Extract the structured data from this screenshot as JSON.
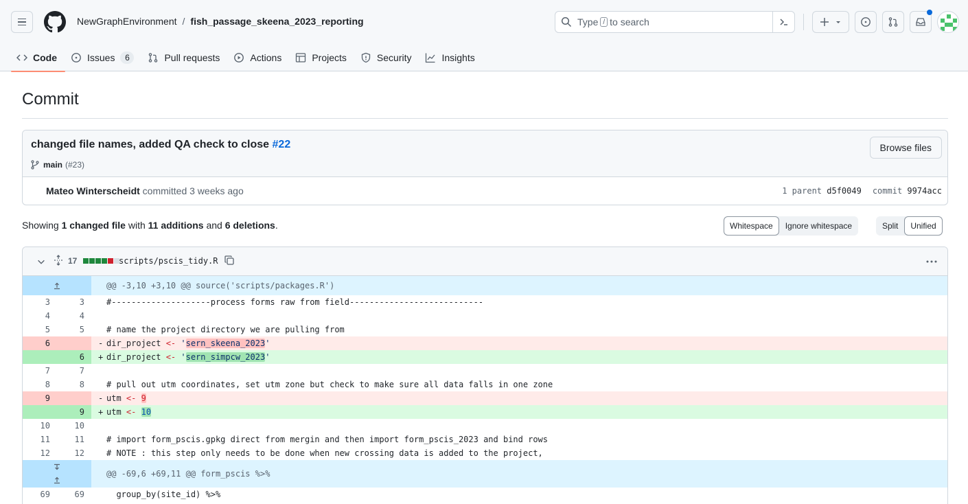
{
  "header": {
    "owner": "NewGraphEnvironment",
    "separator": "/",
    "repo": "fish_passage_skeena_2023_reporting",
    "search_prefix": "Type",
    "search_key": "/",
    "search_suffix": "to search"
  },
  "tabs": [
    {
      "label": "Code",
      "icon": "code-icon",
      "active": true
    },
    {
      "label": "Issues",
      "icon": "issue-icon",
      "count": "6"
    },
    {
      "label": "Pull requests",
      "icon": "pull-request-icon"
    },
    {
      "label": "Actions",
      "icon": "play-icon"
    },
    {
      "label": "Projects",
      "icon": "table-icon"
    },
    {
      "label": "Security",
      "icon": "shield-icon"
    },
    {
      "label": "Insights",
      "icon": "graph-icon"
    }
  ],
  "page": {
    "title": "Commit"
  },
  "commit": {
    "message": "changed file names, added QA check to close",
    "issue_link": "#22",
    "branch": "main",
    "pr_ref": "(#23)",
    "browse_label": "Browse files",
    "author": "Mateo Winterscheidt",
    "action": "committed 3 weeks ago",
    "parent_label": "1 parent",
    "parent_sha": "d5f0049",
    "commit_label": "commit",
    "commit_sha": "9974acc"
  },
  "summary": {
    "showing": "Showing",
    "changed": "1 changed file",
    "with": "with",
    "additions": "11 additions",
    "and": "and",
    "deletions": "6 deletions",
    "end": "."
  },
  "controls": {
    "whitespace": "Whitespace",
    "ignore_whitespace": "Ignore whitespace",
    "split": "Split",
    "unified": "Unified"
  },
  "file": {
    "changes": "17",
    "path": "scripts/pscis_tidy.R",
    "diffstat": [
      "add",
      "add",
      "add",
      "add",
      "del",
      "neutral"
    ]
  },
  "diff": {
    "hunk1": "@@ -3,10 +3,10 @@ source('scripts/packages.R')",
    "hunk2": "@@ -69,6 +69,11 @@ form_pscis %>%",
    "lines": [
      {
        "old": "3",
        "new": "3",
        "text": "#--------------------process forms raw from field---------------------------"
      },
      {
        "old": "4",
        "new": "4",
        "text": ""
      },
      {
        "old": "5",
        "new": "5",
        "text": "# name the project directory we are pulling from"
      },
      {
        "old": "6",
        "new": "",
        "pre": "dir_project ",
        "op": "<-",
        "mid": " '",
        "hl": "sern_skeena_2023",
        "post": "'"
      },
      {
        "old": "",
        "new": "6",
        "pre": "dir_project ",
        "op": "<-",
        "mid": " '",
        "hl": "sern_simpcw_2023",
        "post": "'"
      },
      {
        "old": "7",
        "new": "7",
        "text": ""
      },
      {
        "old": "8",
        "new": "8",
        "text": "# pull out utm coordinates, set utm zone but check to make sure all data falls in one zone"
      },
      {
        "old": "9",
        "new": "",
        "pre": "utm ",
        "op": "<-",
        "mid": " ",
        "hl": "9",
        "post": ""
      },
      {
        "old": "",
        "new": "9",
        "pre": "utm ",
        "op": "<-",
        "mid": " ",
        "hl": "10",
        "post": ""
      },
      {
        "old": "10",
        "new": "10",
        "text": ""
      },
      {
        "old": "11",
        "new": "11",
        "text": "# import form_pscis.gpkg direct from mergin and then import form_pscis_2023 and bind rows"
      },
      {
        "old": "12",
        "new": "12",
        "text": "# NOTE : this step only needs to be done when new crossing data is added to the project,"
      },
      {
        "old": "69",
        "new": "69",
        "text": "  group_by(site_id) %>%"
      }
    ]
  },
  "colors": {
    "accent": "#0969da",
    "tab_underline": "#fd8c73",
    "add_bg": "#dafbe1",
    "del_bg": "#ffebe9",
    "hunk_bg": "#ddf4ff"
  }
}
